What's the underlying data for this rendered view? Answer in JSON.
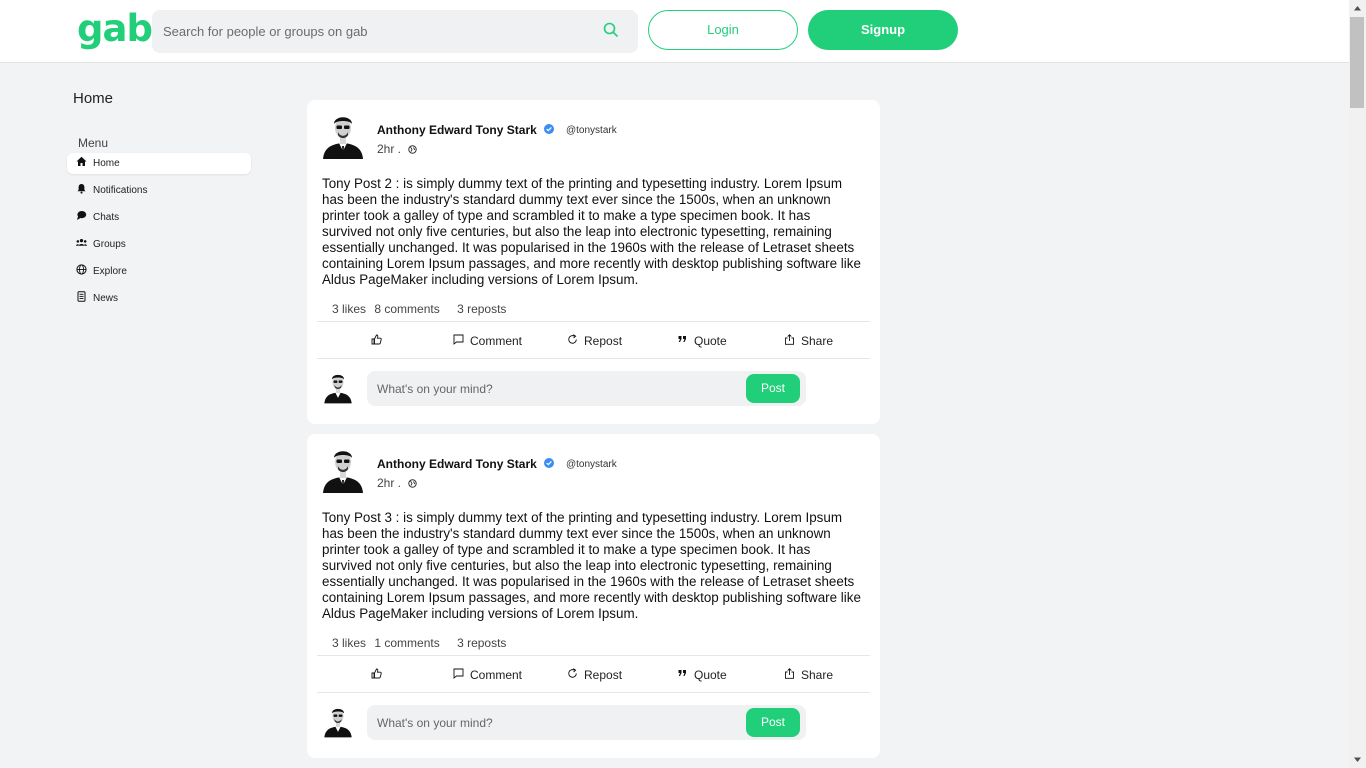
{
  "header": {
    "logo": "gab",
    "search_placeholder": "Search for people or groups on gab",
    "login_label": "Login",
    "signup_label": "Signup",
    "brand_color": "#21cf7a"
  },
  "sidebar": {
    "title": "Home",
    "menu_label": "Menu",
    "items": [
      {
        "label": "Home",
        "icon": "home-icon",
        "active": true
      },
      {
        "label": "Notifications",
        "icon": "bell-icon"
      },
      {
        "label": "Chats",
        "icon": "chat-icon"
      },
      {
        "label": "Groups",
        "icon": "groups-icon"
      },
      {
        "label": "Explore",
        "icon": "globe-icon"
      },
      {
        "label": "News",
        "icon": "news-icon"
      }
    ]
  },
  "posts": [
    {
      "author": "Anthony Edward Tony Stark",
      "handle": "@tonystark",
      "time": "2hr .",
      "text": "Tony Post 2 : is simply dummy text of the printing and typesetting industry. Lorem Ipsum has been the industry's standard dummy text ever since the 1500s, when an unknown printer took a galley of type and scrambled it to make a type specimen book. It has survived not only five centuries, but also the leap into electronic typesetting, remaining essentially unchanged. It was popularised in the 1960s with the release of Letraset sheets containing Lorem Ipsum passages, and more recently with desktop publishing software like Aldus PageMaker including versions of Lorem Ipsum.",
      "likes": "3 likes",
      "comments": "8 comments",
      "reposts": "3 reposts"
    },
    {
      "author": "Anthony Edward Tony Stark",
      "handle": "@tonystark",
      "time": "2hr .",
      "text": "Tony Post 3 : is simply dummy text of the printing and typesetting industry. Lorem Ipsum has been the industry's standard dummy text ever since the 1500s, when an unknown printer took a galley of type and scrambled it to make a type specimen book. It has survived not only five centuries, but also the leap into electronic typesetting, remaining essentially unchanged. It was popularised in the 1960s with the release of Letraset sheets containing Lorem Ipsum passages, and more recently with desktop publishing software like Aldus PageMaker including versions of Lorem Ipsum.",
      "likes": "3 likes",
      "comments": "1 comments",
      "reposts": "3 reposts"
    }
  ],
  "actions": {
    "comment": "Comment",
    "repost": "Repost",
    "quote": "Quote",
    "share": "Share"
  },
  "composer": {
    "placeholder": "What's on your mind?",
    "post_label": "Post"
  }
}
